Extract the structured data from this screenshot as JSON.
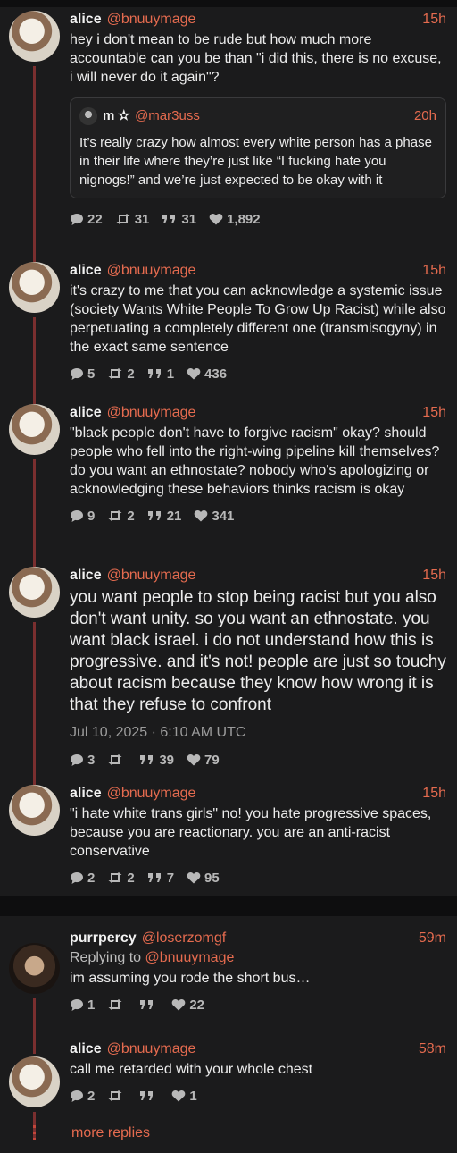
{
  "posts": [
    {
      "name": "alice",
      "handle": "@bnuuymage",
      "time": "15h",
      "text": "hey i don't mean to be rude but how much more accountable can you be than \"i did this, there is no excuse, i will never do it again\"?",
      "quote": {
        "name": "m ✫",
        "handle": "@mar3uss",
        "time": "20h",
        "text": "It’s really crazy how almost every white person has a phase in their life where they’re just like “I fucking hate you nignogs!” and we’re just expected to be okay with it"
      },
      "stats": {
        "replies": "22",
        "reposts": "31",
        "quotes": "31",
        "likes": "1,892"
      }
    },
    {
      "name": "alice",
      "handle": "@bnuuymage",
      "time": "15h",
      "text": "it's crazy to me that you can acknowledge a systemic issue (society Wants White People To Grow Up Racist) while also perpetuating a completely different one (transmisogyny) in the exact same sentence",
      "stats": {
        "replies": "5",
        "reposts": "2",
        "quotes": "1",
        "likes": "436"
      }
    },
    {
      "name": "alice",
      "handle": "@bnuuymage",
      "time": "15h",
      "text": "\"black people don't have to forgive racism\" okay? should people who fell into the right-wing pipeline kill themselves? do you want an ethnostate? nobody who's apologizing or acknowledging these behaviors thinks racism is okay",
      "stats": {
        "replies": "9",
        "reposts": "2",
        "quotes": "21",
        "likes": "341"
      }
    },
    {
      "name": "alice",
      "handle": "@bnuuymage",
      "time": "15h",
      "text": "you want people to stop being racist but you also don't want unity. so you want an ethnostate. you want black israel. i do not understand how this is progressive. and it's not! people are just so touchy about racism  because they know how wrong it is that they refuse to confront",
      "date": "Jul 10, 2025 · 6:10 AM UTC",
      "stats": {
        "replies": "3",
        "reposts": "",
        "quotes": "39",
        "likes": "79"
      }
    },
    {
      "name": "alice",
      "handle": "@bnuuymage",
      "time": "15h",
      "text": "\"i hate white trans girls\" no! you hate progressive spaces, because you are reactionary. you are an anti-racist conservative",
      "stats": {
        "replies": "2",
        "reposts": "2",
        "quotes": "7",
        "likes": "95"
      }
    }
  ],
  "replies": [
    {
      "name": "purrpercy",
      "handle": "@loserzomgf",
      "time": "59m",
      "replying_label": "Replying to",
      "replying_handle": "@bnuuymage",
      "text": "im assuming you rode the short bus…",
      "stats": {
        "replies": "1",
        "reposts": "",
        "quotes": "",
        "likes": "22"
      }
    },
    {
      "name": "alice",
      "handle": "@bnuuymage",
      "time": "58m",
      "text": "call me retarded with your whole chest",
      "stats": {
        "replies": "2",
        "reposts": "",
        "quotes": "",
        "likes": "1"
      }
    }
  ],
  "more_replies": "more replies",
  "colors": {
    "accent": "#e56b4f",
    "thread_line": "#7a2f2f",
    "background": "#1b1b1c"
  }
}
